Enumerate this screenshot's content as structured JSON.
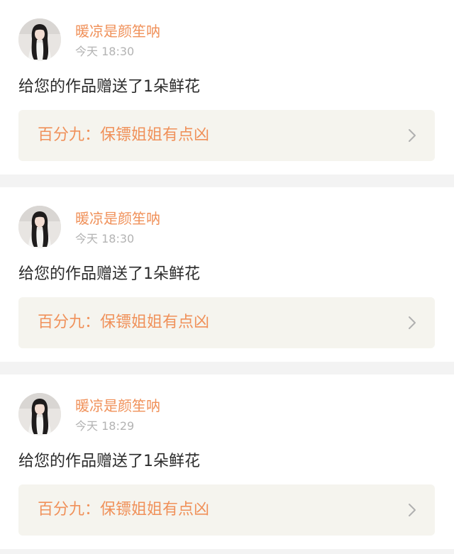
{
  "notifications": [
    {
      "user": "暖凉是颜笙呐",
      "time": "今天 18:30",
      "message": "给您的作品赠送了1朵鲜花",
      "work": "百分九：保镖姐姐有点凶",
      "avatar_icon": "user-avatar-photo",
      "chevron_icon": "chevron-right-icon"
    },
    {
      "user": "暖凉是颜笙呐",
      "time": "今天 18:30",
      "message": "给您的作品赠送了1朵鲜花",
      "work": "百分九：保镖姐姐有点凶",
      "avatar_icon": "user-avatar-photo",
      "chevron_icon": "chevron-right-icon"
    },
    {
      "user": "暖凉是颜笙呐",
      "time": "今天 18:29",
      "message": "给您的作品赠送了1朵鲜花",
      "work": "百分九：保镖姐姐有点凶",
      "avatar_icon": "user-avatar-photo",
      "chevron_icon": "chevron-right-icon"
    }
  ],
  "colors": {
    "accent": "#f0915a",
    "tab_indicator": "#e0779c",
    "link_background": "#f5f4ee",
    "page_background": "#f3f3f3"
  }
}
